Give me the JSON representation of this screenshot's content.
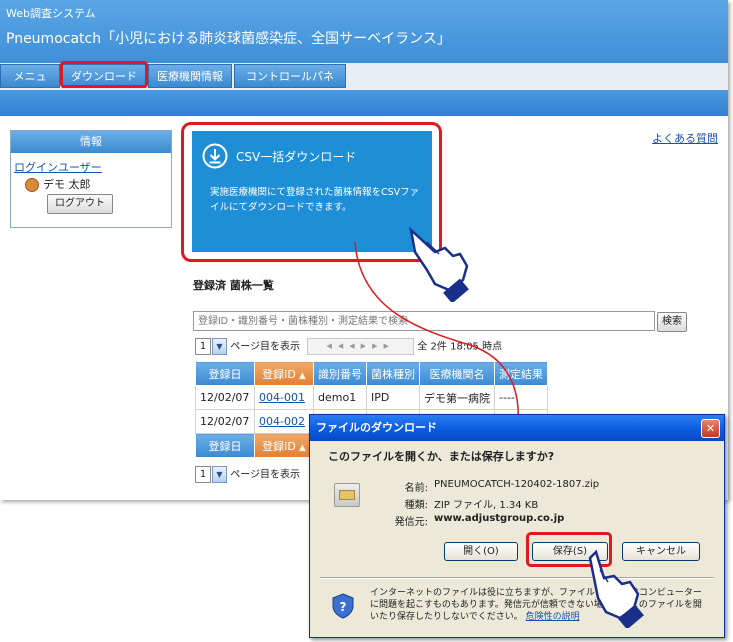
{
  "header": {
    "system_title": "Web調査システム",
    "main_title": "Pneumocatch「小児における肺炎球菌感染症、全国サーベイランス」"
  },
  "tabs": [
    {
      "label": "メニュー"
    },
    {
      "label": "ダウンロード"
    },
    {
      "label": "医療機関情報"
    },
    {
      "label": "コントロールパネル"
    }
  ],
  "sidebar": {
    "heading": "情報",
    "login_user_label": "ログインユーザー",
    "user_name": "デモ 太郎",
    "logout_label": "ログアウト"
  },
  "faq_link": "よくある質問",
  "csv_tile": {
    "title": "CSV一括ダウンロード",
    "description": "実施医療機関にて登録された菌株情報をCSVファイルにてダウンロードできます。"
  },
  "list": {
    "title": "登録済 菌株一覧",
    "search_placeholder": "登録ID・識別番号・菌株種別・測定結果で検索",
    "search_button": "検索",
    "page_select": "1",
    "page_label": "ページ目を表示",
    "status_text": "全 2件 18:05 時点",
    "columns": [
      "登録日",
      "登録ID",
      "識別番号",
      "菌株種別",
      "医療機関名",
      "測定結果"
    ],
    "rows": [
      [
        "12/02/07",
        "004-001",
        "demo1",
        "IPD",
        "デモ第一病院",
        "----"
      ],
      [
        "12/02/07",
        "004-002",
        "",
        "",
        "",
        ""
      ]
    ]
  },
  "dialog": {
    "title": "ファイルのダウンロード",
    "question": "このファイルを開くか、または保存しますか?",
    "name_label": "名前:",
    "name_value": "PNEUMOCATCH-120402-1807.zip",
    "type_label": "種類:",
    "type_value": "ZIP ファイル, 1.34 KB",
    "from_label": "発信元:",
    "from_value": "www.adjustgroup.co.jp",
    "open_button": "開く(O)",
    "save_button": "保存(S)",
    "cancel_button": "キャンセル",
    "warning_text": "インターネットのファイルは役に立ちますが、ファイルによってはコンピューターに問題を起こすものもあります。発信元が信頼できない場合は、このファイルを開いたり保存したりしないでください。",
    "warning_link": "危険性の説明"
  },
  "colors": {
    "header_blue": "#3f8fd8",
    "tile_blue": "#1e8fd6",
    "highlight_red": "#e0191e",
    "sort_orange": "#e07f33"
  }
}
